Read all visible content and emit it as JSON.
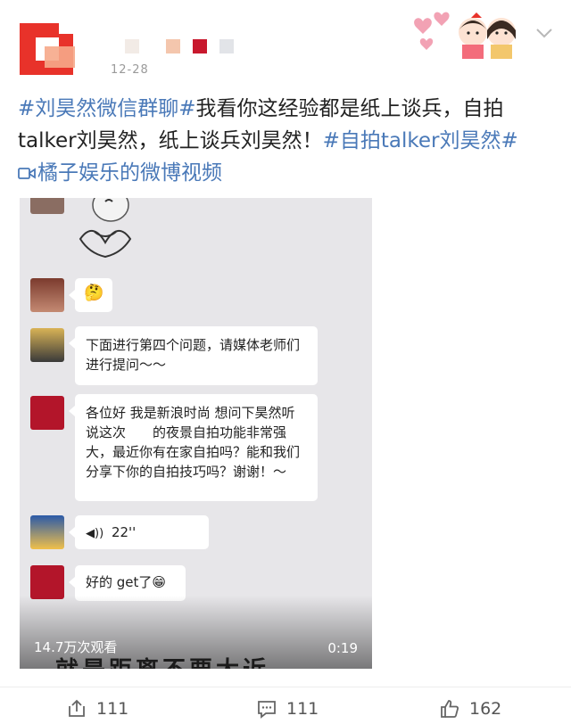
{
  "header": {
    "timestamp": "12-28",
    "avatar_colors": [
      "#e8322a",
      "#f6a889"
    ],
    "blur_colors": [
      "#f0e6e0",
      "#f4c6ad",
      "#c8182d",
      "#e2e4e8"
    ]
  },
  "post": {
    "tag_1": "#刘昊然微信群聊#",
    "text_1": "我看你这经验都是纸上谈兵，自拍talker刘昊然，纸上谈兵刘昊然！",
    "tag_2": "#自拍talker刘昊然#",
    "video_link": "橘子娱乐的微博视频",
    "link_color": "#4a79b8"
  },
  "video": {
    "messages": [
      {
        "emoji": "🤔"
      },
      {
        "text": "下面进行第四个问题，请媒体老师们进行提问～～"
      },
      {
        "text": "各位好 我是新浪时尚 想问下昊然听说这次　　的夜景自拍功能非常强大，最近你有在家自拍吗？能和我们分享下你的自拍技巧吗？谢谢！～"
      },
      {
        "voice": "22''"
      },
      {
        "text": "好的 get了",
        "emoji": "😁"
      }
    ],
    "subtitle_peek": "就是距离不要太近",
    "views": "14.7万次观看",
    "duration": "0:19"
  },
  "footer": {
    "share_count": "111",
    "comment_count": "111",
    "like_count": "162"
  }
}
